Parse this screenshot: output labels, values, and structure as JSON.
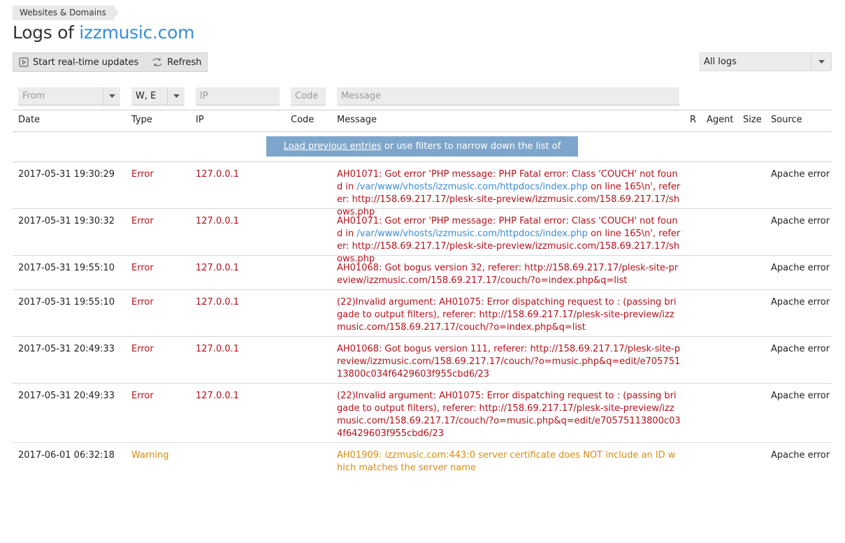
{
  "breadcrumb": "Websites & Domains",
  "title": {
    "prefix": "Logs of",
    "domain": "izzmusic.com"
  },
  "toolbar": {
    "realtime_label": "Start real-time updates",
    "refresh_label": "Refresh"
  },
  "log_select": {
    "value": "All logs"
  },
  "filters": {
    "from_placeholder": "From",
    "type_value": "W, E",
    "ip_placeholder": "IP",
    "code_placeholder": "Code",
    "message_placeholder": "Message"
  },
  "columns": {
    "date": "Date",
    "type": "Type",
    "ip": "IP",
    "code": "Code",
    "message": "Message",
    "r": "R",
    "agent": "Agent",
    "size": "Size",
    "source": "Source"
  },
  "load_bar": {
    "link": "Load previous entries",
    "rest": " or use filters to narrow down the list of entries."
  },
  "colors": {
    "error": "#b5121b",
    "warning": "#d38e12",
    "link": "#3a8bd8"
  },
  "rows": [
    {
      "date": "2017-05-31 19:30:29",
      "type": "Error",
      "ip": "127.0.0.1",
      "source": "Apache error",
      "msg_a": "AH01071: Got error 'PHP message: PHP Fatal error: Class 'COUCH' not found in ",
      "msg_link": "/var/www/vhosts/izzmusic.com/httpdocs/index.php",
      "msg_b": " on line 165\\n', referer: http://158.69.217.17/plesk-site-preview/izzmusic.com/158.69.217.17/shows.php"
    },
    {
      "date": "2017-05-31 19:30:32",
      "type": "Error",
      "ip": "127.0.0.1",
      "source": "Apache error",
      "msg_a": "AH01071: Got error 'PHP message: PHP Fatal error: Class 'COUCH' not found in ",
      "msg_link": "/var/www/vhosts/izzmusic.com/httpdocs/index.php",
      "msg_b": " on line 165\\n', referer: http://158.69.217.17/plesk-site-preview/izzmusic.com/158.69.217.17/shows.php"
    },
    {
      "date": "2017-05-31 19:55:10",
      "type": "Error",
      "ip": "127.0.0.1",
      "source": "Apache error",
      "msg_a": "AH01068: Got bogus version 32, referer: http://158.69.217.17/plesk-site-preview/izzmusic.com/158.69.217.17/couch/?o=index.php&q=list",
      "msg_link": "",
      "msg_b": ""
    },
    {
      "date": "2017-05-31 19:55:10",
      "type": "Error",
      "ip": "127.0.0.1",
      "source": "Apache error",
      "msg_a": "(22)Invalid argument: AH01075: Error dispatching request to : (passing brigade to output filters), referer: http://158.69.217.17/plesk-site-preview/izzmusic.com/158.69.217.17/couch/?o=index.php&q=list",
      "msg_link": "",
      "msg_b": ""
    },
    {
      "date": "2017-05-31 20:49:33",
      "type": "Error",
      "ip": "127.0.0.1",
      "source": "Apache error",
      "msg_a": "AH01068: Got bogus version 111, referer: http://158.69.217.17/plesk-site-preview/izzmusic.com/158.69.217.17/couch/?o=music.php&q=edit/e70575113800c034f6429603f955cbd6/23",
      "msg_link": "",
      "msg_b": ""
    },
    {
      "date": "2017-05-31 20:49:33",
      "type": "Error",
      "ip": "127.0.0.1",
      "source": "Apache error",
      "msg_a": "(22)Invalid argument: AH01075: Error dispatching request to : (passing brigade to output filters), referer: http://158.69.217.17/plesk-site-preview/izzmusic.com/158.69.217.17/couch/?o=music.php&q=edit/e70575113800c034f6429603f955cbd6/23",
      "msg_link": "",
      "msg_b": ""
    },
    {
      "date": "2017-06-01 06:32:18",
      "type": "Warning",
      "ip": "",
      "source": "Apache error",
      "msg_a": "AH01909: izzmusic.com:443:0 server certificate does NOT include an ID which matches the server name",
      "msg_link": "",
      "msg_b": ""
    }
  ]
}
